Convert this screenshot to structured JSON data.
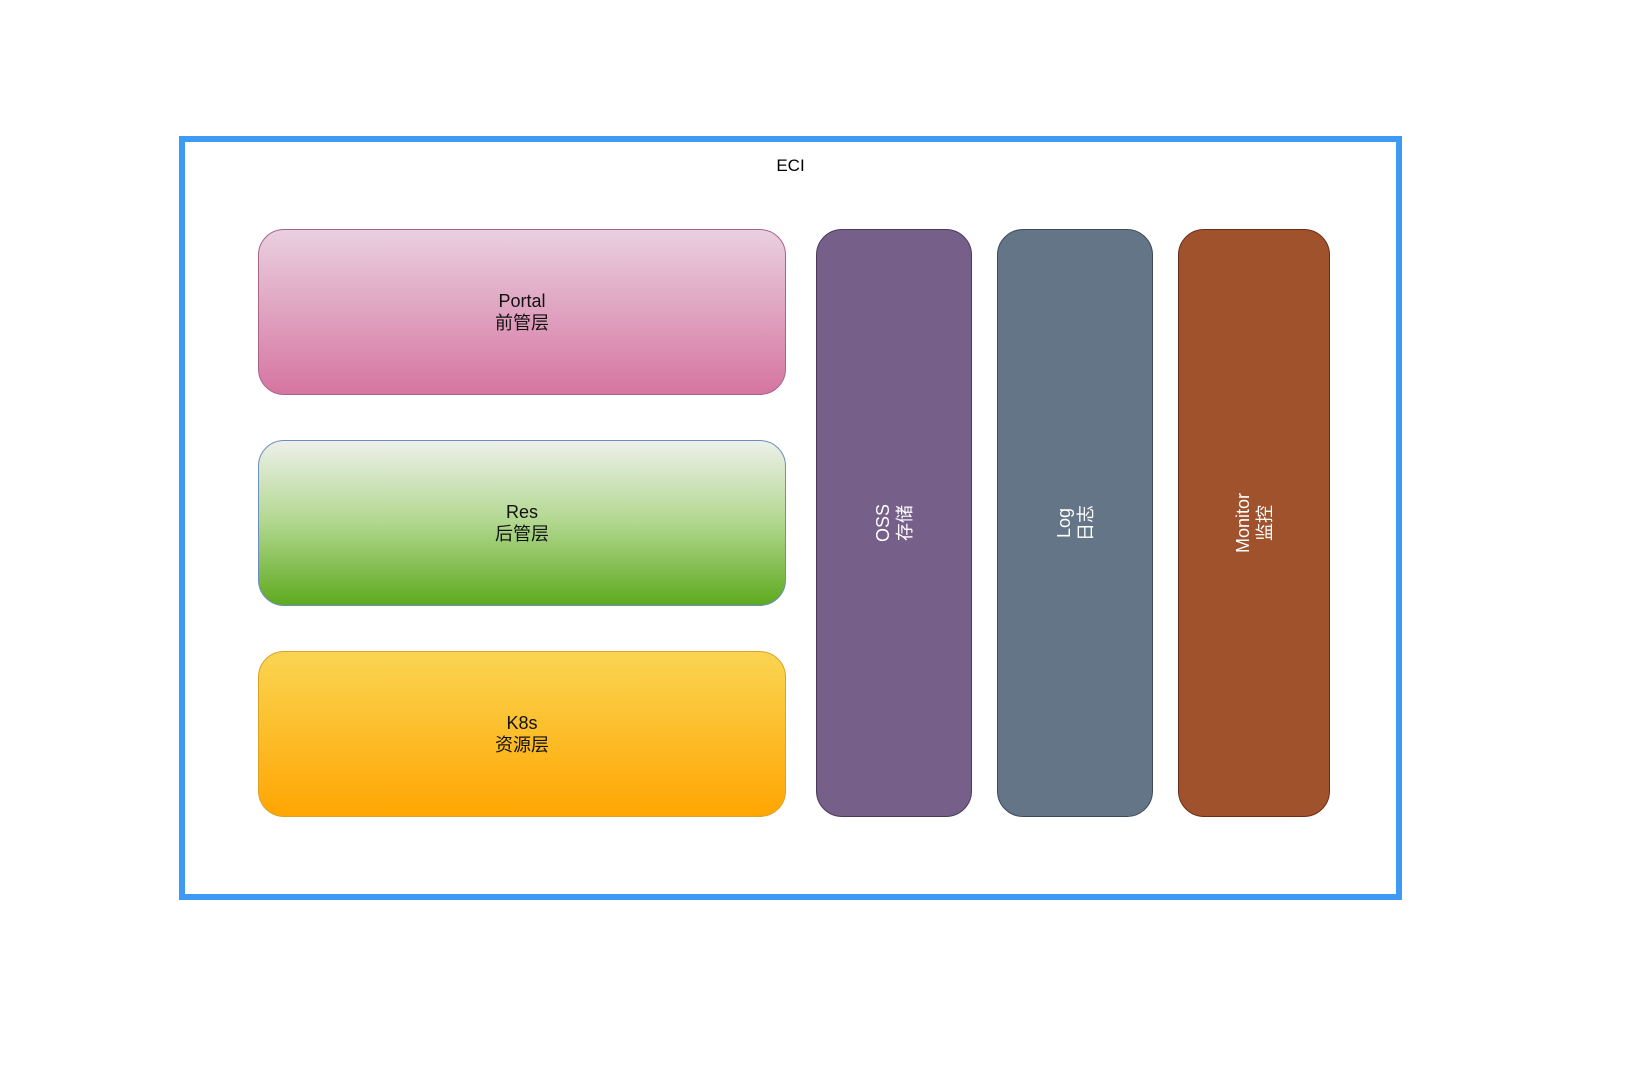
{
  "diagram": {
    "container": {
      "title": "ECI",
      "border_color": "#3d9bf5"
    },
    "layers": [
      {
        "name": "Portal",
        "subtitle": "前管层",
        "colors": [
          "#e9d0df",
          "#d675a1"
        ]
      },
      {
        "name": "Res",
        "subtitle": "后管层",
        "colors": [
          "#edf0ea",
          "#5faa1f"
        ]
      },
      {
        "name": "K8s",
        "subtitle": "资源层",
        "colors": [
          "#fad552",
          "#ffa602"
        ]
      }
    ],
    "pillars": [
      {
        "name": "OSS",
        "subtitle": "存储",
        "color": "#765f88"
      },
      {
        "name": "Log",
        "subtitle": "日志",
        "color": "#647587"
      },
      {
        "name": "Monitor",
        "subtitle": "监控",
        "color": "#a0522d"
      }
    ]
  }
}
